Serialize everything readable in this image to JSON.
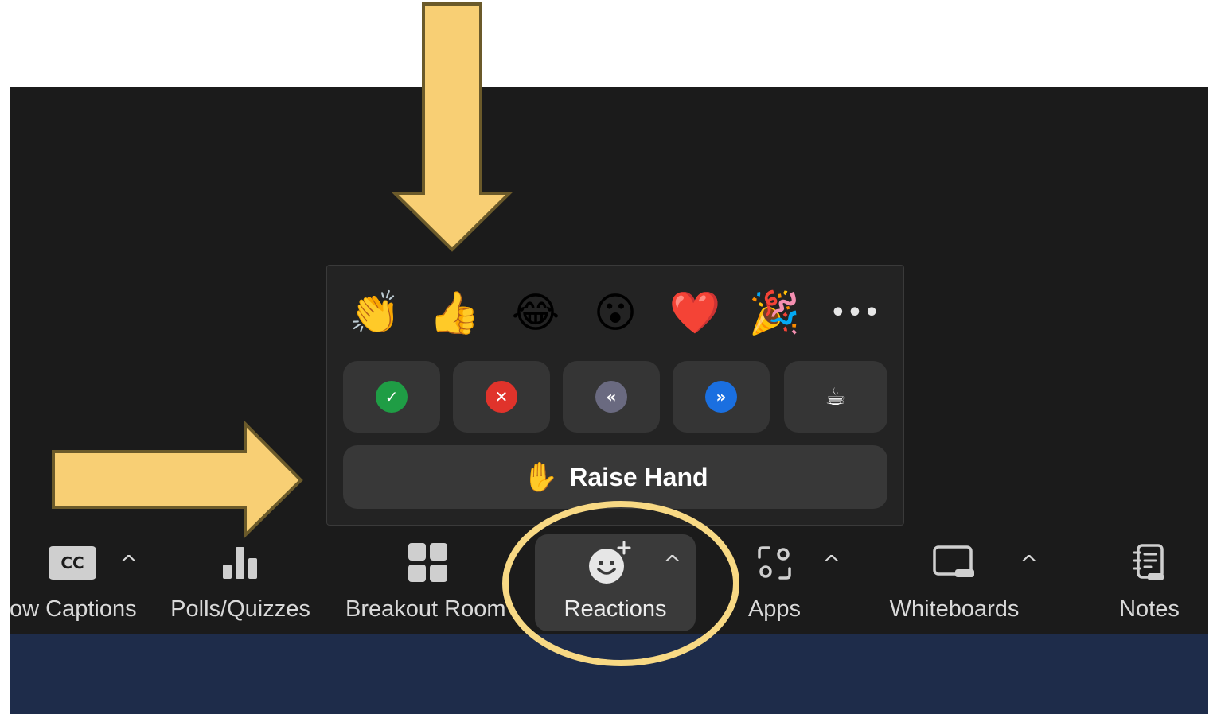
{
  "reactions_popup": {
    "emojis": [
      {
        "icon": "clapping-hands-icon",
        "glyph": "👏"
      },
      {
        "icon": "thumbs-up-icon",
        "glyph": "👍"
      },
      {
        "icon": "tears-of-joy-icon",
        "glyph": "😂"
      },
      {
        "icon": "open-mouth-icon",
        "glyph": "😮"
      },
      {
        "icon": "heart-icon",
        "glyph": "❤️"
      },
      {
        "icon": "party-popper-icon",
        "glyph": "🎉"
      }
    ],
    "more_glyph": "•••",
    "feedback": [
      {
        "icon": "yes-check-icon",
        "glyph": "✓",
        "color": "#1f9d45"
      },
      {
        "icon": "no-x-icon",
        "glyph": "✕",
        "color": "#e0332b"
      },
      {
        "icon": "slow-down-icon",
        "glyph": "«",
        "color": "#6a6a80"
      },
      {
        "icon": "speed-up-icon",
        "glyph": "»",
        "color": "#1a6fe0"
      },
      {
        "icon": "coffee-icon",
        "glyph": "☕",
        "color": "transparent"
      }
    ],
    "raise_hand_glyph": "✋",
    "raise_hand_label": "Raise Hand"
  },
  "toolbar": {
    "captions": "ow Captions",
    "polls": "Polls/Quizzes",
    "breakout": "Breakout Room",
    "reactions": "Reactions",
    "apps": "Apps",
    "whiteboards": "Whiteboards",
    "notes": "Notes",
    "cc_icon_text": "CC",
    "caret": "^"
  },
  "colors": {
    "annotation": "#f8cf74",
    "annotation_outline": "#6b5a2a",
    "window_bg": "#1b1b1b",
    "bottom_strip": "#1e2c4a"
  }
}
